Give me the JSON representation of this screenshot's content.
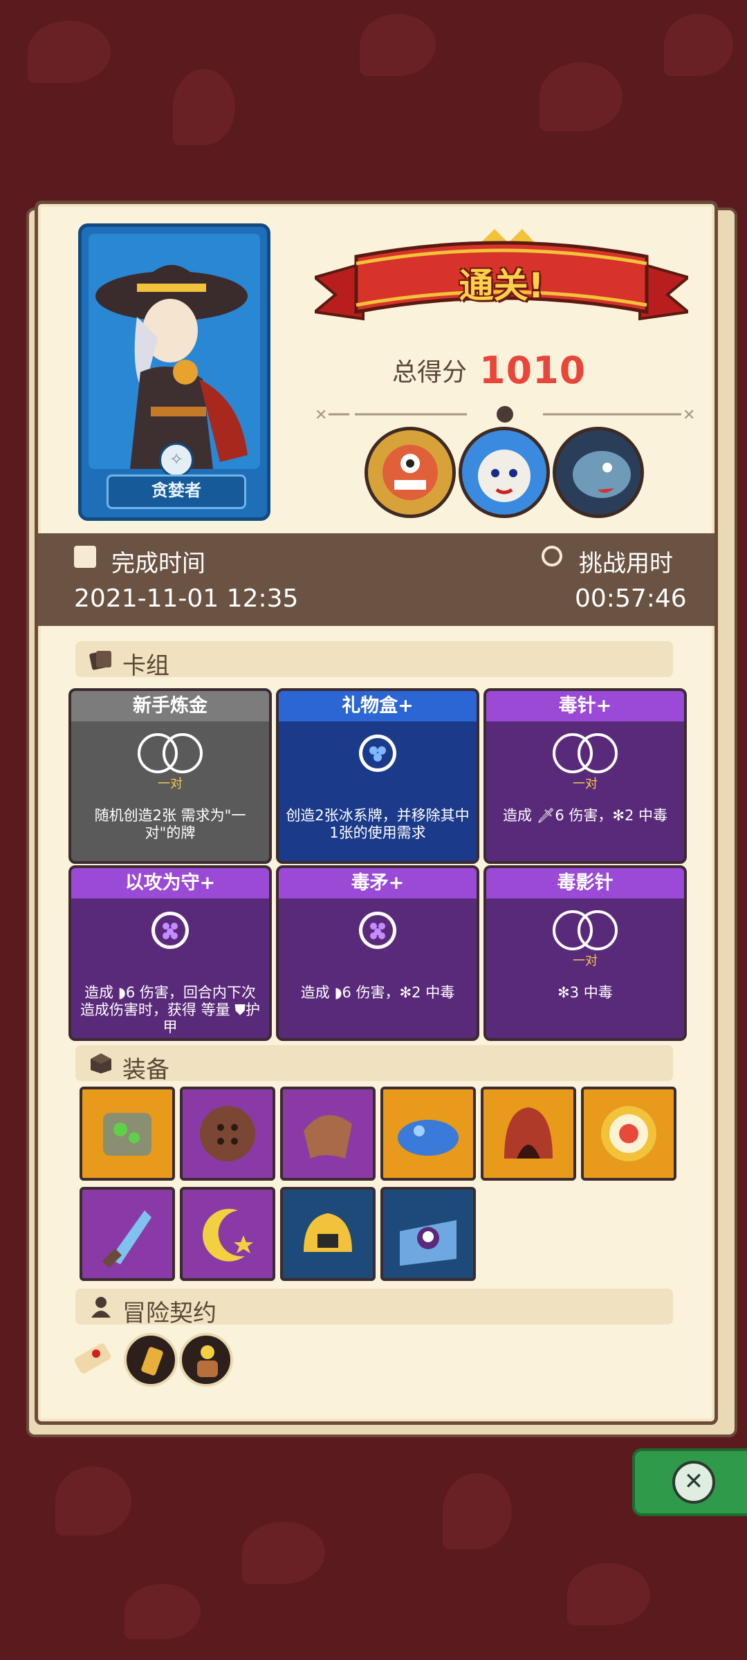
{
  "hero": {
    "name": "贪婪者"
  },
  "result": {
    "banner": "通关!",
    "score_label": "总得分",
    "score_value": "1010"
  },
  "stats": {
    "completion_label": "完成时间",
    "completion_value": "2021-11-01 12:35",
    "duration_label": "挑战用时",
    "duration_value": "00:57:46"
  },
  "sections": {
    "deck": "卡组",
    "equipment": "装备",
    "contracts": "冒险契约"
  },
  "deck": [
    {
      "title": "新手炼金",
      "variant": "gray",
      "emblem": "pair",
      "tag": "一对",
      "desc": "随机创造2张 需求为\"一对\"的牌"
    },
    {
      "title": "礼物盒+",
      "variant": "blue",
      "emblem": "ice",
      "tag": "",
      "desc": "创造2张冰系牌，并移除其中1张的使用需求"
    },
    {
      "title": "毒针+",
      "variant": "purple",
      "emblem": "pair",
      "tag": "一对",
      "desc": "造成 🗡6 伤害，✻2 中毒"
    },
    {
      "title": "以攻为守+",
      "variant": "purple",
      "emblem": "grape",
      "tag": "",
      "desc": "造成 ◗6 伤害，回合内下次造成伤害时，获得 等量 ⛊护甲"
    },
    {
      "title": "毒矛+",
      "variant": "purple",
      "emblem": "grape",
      "tag": "",
      "desc": "造成 ◗6 伤害，✻2 中毒"
    },
    {
      "title": "毒影针",
      "variant": "purple",
      "emblem": "pair",
      "tag": "一对",
      "desc": "✻3 中毒"
    }
  ],
  "equipment": [
    {
      "icon": "moss-stone-icon",
      "color": "orange"
    },
    {
      "icon": "button-icon",
      "color": "purple"
    },
    {
      "icon": "leather-gauntlet-icon",
      "color": "purple"
    },
    {
      "icon": "blue-slime-icon",
      "color": "orange"
    },
    {
      "icon": "red-hood-icon",
      "color": "orange"
    },
    {
      "icon": "gold-ring-icon",
      "color": "orange"
    },
    {
      "icon": "ice-dagger-icon",
      "color": "purple"
    },
    {
      "icon": "moon-star-icon",
      "color": "purple"
    },
    {
      "icon": "gold-helmet-icon",
      "color": "blue"
    },
    {
      "icon": "skull-book-icon",
      "color": "blue"
    }
  ],
  "contracts": [
    {
      "icon": "scroll-icon"
    },
    {
      "icon": "amulet-icon"
    },
    {
      "icon": "flower-pot-icon"
    }
  ]
}
